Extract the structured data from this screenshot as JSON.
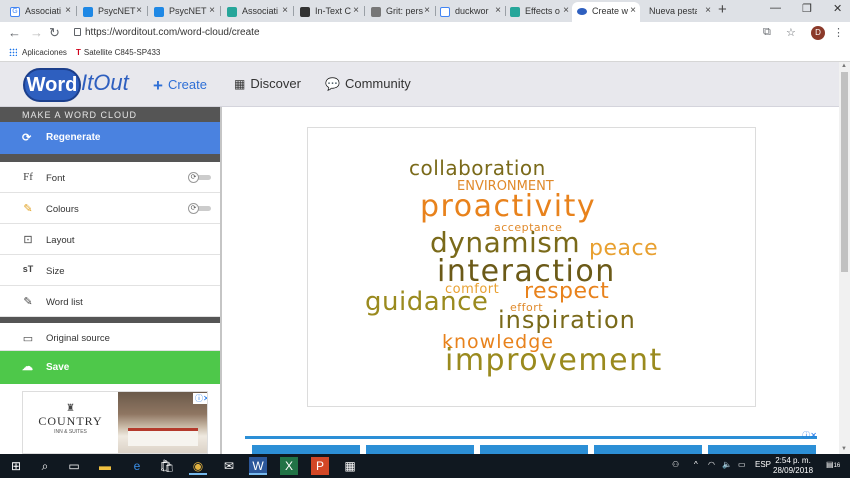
{
  "browser": {
    "tabs": [
      {
        "label": "Associati",
        "icon_color": "#4285f4",
        "icon": "G"
      },
      {
        "label": "PsycNET",
        "icon_color": "#1e88e5",
        "icon": "◣"
      },
      {
        "label": "PsycNET",
        "icon_color": "#1e88e5",
        "icon": "◣"
      },
      {
        "label": "Associati",
        "icon_color": "#26a69a",
        "icon": "R"
      },
      {
        "label": "In-Text C",
        "icon_color": "#333333",
        "icon": "ru"
      },
      {
        "label": "Grit: pers",
        "icon_color": "#555555",
        "icon": "G"
      },
      {
        "label": "duckwor",
        "icon_color": "#4285f4",
        "icon": "G"
      },
      {
        "label": "Effects o",
        "icon_color": "#26a69a",
        "icon": "R"
      },
      {
        "label": "Create w",
        "icon_color": "#2e5fbf",
        "icon": "●"
      },
      {
        "label": "Nueva pestañ",
        "icon_color": "#ffffff",
        "icon": ""
      }
    ],
    "url": "https://worditout.com/word-cloud/create",
    "bookmarks": [
      {
        "label": "Aplicaciones"
      },
      {
        "label": "Satellite C845-SP433"
      }
    ]
  },
  "site": {
    "logo_word": "Word",
    "logo_itout": "ItOut",
    "nav": [
      {
        "label": "Create",
        "icon": "plus-icon"
      },
      {
        "label": "Discover",
        "icon": "grid-icon"
      },
      {
        "label": "Community",
        "icon": "chat-icon"
      }
    ]
  },
  "sidebar": {
    "title": "MAKE A WORD CLOUD",
    "regenerate": "Regenerate",
    "items": [
      {
        "label": "Font",
        "glyph": "Ff"
      },
      {
        "label": "Colours",
        "glyph": "✎"
      },
      {
        "label": "Layout",
        "glyph": "⊡"
      },
      {
        "label": "Size",
        "glyph": "sT"
      },
      {
        "label": "Word list",
        "glyph": "✎"
      }
    ],
    "original_source": "Original source",
    "save": "Save"
  },
  "ad": {
    "brand": "COUNTRY",
    "subtitle": "INN & SUITES"
  },
  "cloud": {
    "words": [
      {
        "text": "collaboration",
        "color": "#7a6a1a"
      },
      {
        "text": "ENVIRONMENT",
        "color": "#e0892a"
      },
      {
        "text": "proactivity",
        "color": "#e8821c"
      },
      {
        "text": "acceptance",
        "color": "#e0892a"
      },
      {
        "text": "dynamism",
        "color": "#7a6a1a"
      },
      {
        "text": "peace",
        "color": "#e8a030"
      },
      {
        "text": "interaction",
        "color": "#6b5a18"
      },
      {
        "text": "comfort",
        "color": "#e8a030"
      },
      {
        "text": "respect",
        "color": "#e8821c"
      },
      {
        "text": "guidance",
        "color": "#9a8a1e"
      },
      {
        "text": "effort",
        "color": "#e0892a"
      },
      {
        "text": "inspiration",
        "color": "#7a6a1a"
      },
      {
        "text": "knowledge",
        "color": "#e8821c"
      },
      {
        "text": "improvement",
        "color": "#9a8a1e"
      }
    ]
  },
  "taskbar": {
    "clock_time": "2:54 p. m.",
    "clock_date": "28/09/2018",
    "language": "ESP",
    "notifications": "16"
  }
}
